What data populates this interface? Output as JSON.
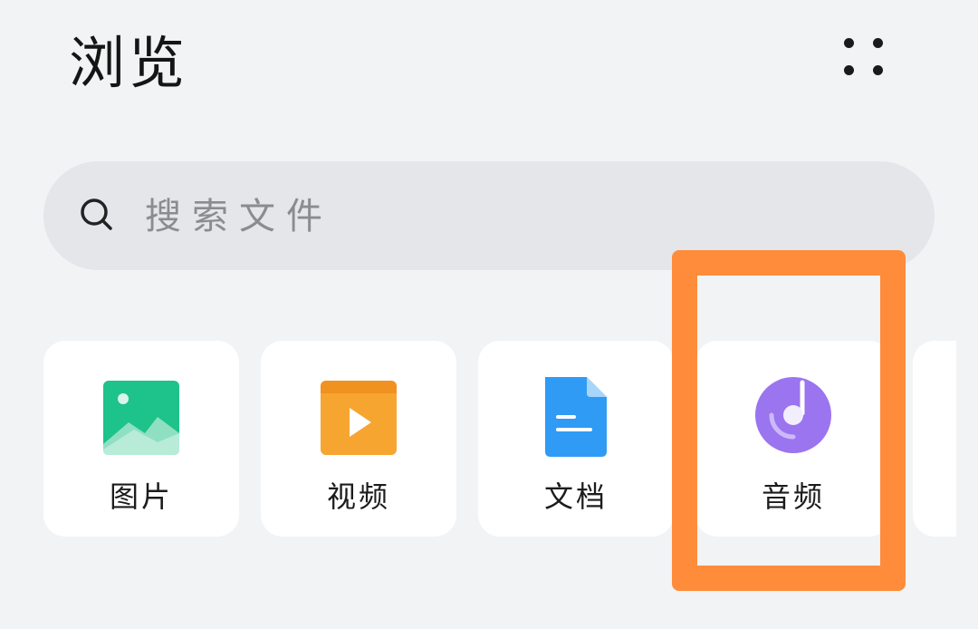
{
  "header": {
    "title": "浏览",
    "more_icon": "more-dots-icon"
  },
  "search": {
    "placeholder": "搜索文件",
    "icon": "search-icon"
  },
  "categories": [
    {
      "label": "图片",
      "icon": "image-icon",
      "color": "#1ec28b"
    },
    {
      "label": "视频",
      "icon": "video-play-icon",
      "color": "#f7a531"
    },
    {
      "label": "文档",
      "icon": "document-icon",
      "color": "#2f9bf5"
    },
    {
      "label": "音频",
      "icon": "audio-disc-icon",
      "color": "#9b74f0"
    }
  ],
  "annotation": {
    "highlight_color": "#ff8c3a"
  }
}
